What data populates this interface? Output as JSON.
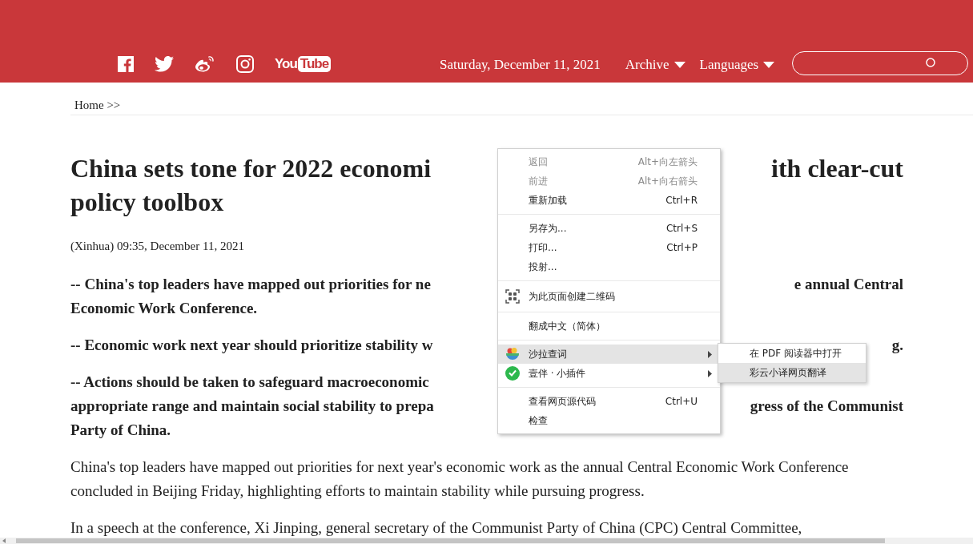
{
  "header": {
    "social": [
      {
        "kind": "facebook"
      },
      {
        "kind": "twitter"
      },
      {
        "kind": "weibo"
      },
      {
        "kind": "instagram"
      },
      {
        "kind": "youtube",
        "label_1": "You",
        "label_2": "Tube"
      }
    ],
    "date": "Saturday, December 11, 2021",
    "nav": [
      {
        "label": "Archive"
      },
      {
        "label": "Languages"
      }
    ]
  },
  "breadcrumb": "Home >>",
  "title_lines": [
    {
      "left": "China sets tone for 2022 economi",
      "right": "ith clear-cut"
    },
    {
      "left": "policy toolbox"
    }
  ],
  "byline": "(Xinhua) 09:35, December 11, 2021",
  "points": [
    [
      {
        "left": "-- China's top leaders have mapped out priorities for ne",
        "right": "e annual Central"
      },
      {
        "left": "Economic Work Conference."
      }
    ],
    [
      {
        "left": "-- Economic work next year should prioritize stability w",
        "right": "g."
      }
    ],
    [
      {
        "left": "-- Actions should be taken to safeguard macroeconomic"
      },
      {
        "left": "appropriate range and maintain social stability to prepa",
        "right": "gress of the Communist"
      },
      {
        "left": "Party of China."
      }
    ]
  ],
  "paragraphs": [
    "China's top leaders have mapped out priorities for next year's economic work as the annual Central Economic Work Conference concluded in Beijing Friday, highlighting efforts to maintain stability while pursuing progress.",
    "In a speech at the conference, Xi Jinping, general secretary of the Communist Party of China (CPC) Central Committee,"
  ],
  "context_menu": {
    "items": [
      {
        "kind": "item",
        "label": "返回",
        "shortcut": "Alt+向左箭头",
        "disabled": true,
        "selected": false
      },
      {
        "kind": "item",
        "label": "前进",
        "shortcut": "Alt+向右箭头",
        "disabled": true,
        "selected": false
      },
      {
        "kind": "item",
        "label": "重新加载",
        "shortcut": "Ctrl+R",
        "disabled": false,
        "selected": false
      },
      {
        "kind": "separator"
      },
      {
        "kind": "item",
        "label": "另存为...",
        "shortcut": "Ctrl+S",
        "disabled": false,
        "selected": false
      },
      {
        "kind": "item",
        "label": "打印...",
        "shortcut": "Ctrl+P",
        "disabled": false,
        "selected": false
      },
      {
        "kind": "item",
        "label": "投射...",
        "disabled": false,
        "selected": false
      },
      {
        "kind": "separator"
      },
      {
        "kind": "icon_item",
        "label": "为此页面创建二维码",
        "disabled": false,
        "selected": false
      },
      {
        "kind": "separator"
      },
      {
        "kind": "item",
        "label": "翻成中文（简体）",
        "disabled": false,
        "selected": false
      },
      {
        "kind": "separator"
      },
      {
        "kind": "submenu",
        "label": "沙拉查词",
        "disabled": false,
        "selected": true
      },
      {
        "kind": "submenu",
        "label": "壹伴 · 小插件",
        "disabled": false,
        "selected": false
      },
      {
        "kind": "separator"
      },
      {
        "kind": "item",
        "label": "查看网页源代码",
        "shortcut": "Ctrl+U",
        "disabled": false,
        "selected": false
      },
      {
        "kind": "item",
        "label": "检查",
        "disabled": false,
        "selected": false
      }
    ]
  },
  "submenu": {
    "items": [
      {
        "label": "在 PDF 阅读器中打开",
        "selected": false
      },
      {
        "label": "彩云小译网页翻译",
        "selected": true
      }
    ]
  }
}
